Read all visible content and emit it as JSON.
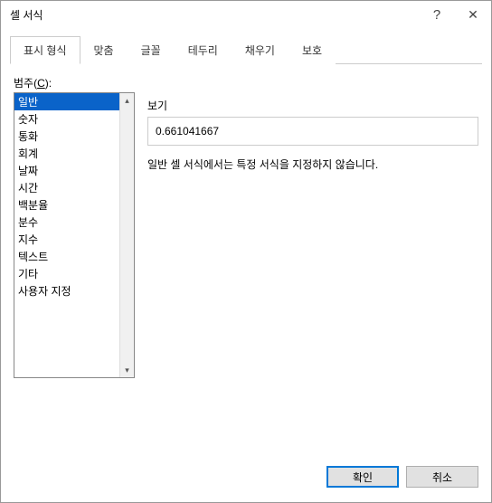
{
  "title": "셀 서식",
  "tabs": {
    "number": "표시 형식",
    "alignment": "맞춤",
    "font": "글꼴",
    "border": "테두리",
    "fill": "채우기",
    "protection": "보호"
  },
  "category": {
    "label_prefix": "범주(",
    "label_key": "C",
    "label_suffix": "):",
    "items": [
      "일반",
      "숫자",
      "통화",
      "회계",
      "날짜",
      "시간",
      "백분율",
      "분수",
      "지수",
      "텍스트",
      "기타",
      "사용자 지정"
    ],
    "selected_index": 0
  },
  "preview": {
    "label": "보기",
    "value": "0.661041667"
  },
  "description": "일반 셀 서식에서는 특정 서식을 지정하지 않습니다.",
  "buttons": {
    "ok": "확인",
    "cancel": "취소"
  },
  "icons": {
    "help": "?",
    "close": "✕",
    "up": "▴",
    "down": "▾"
  }
}
